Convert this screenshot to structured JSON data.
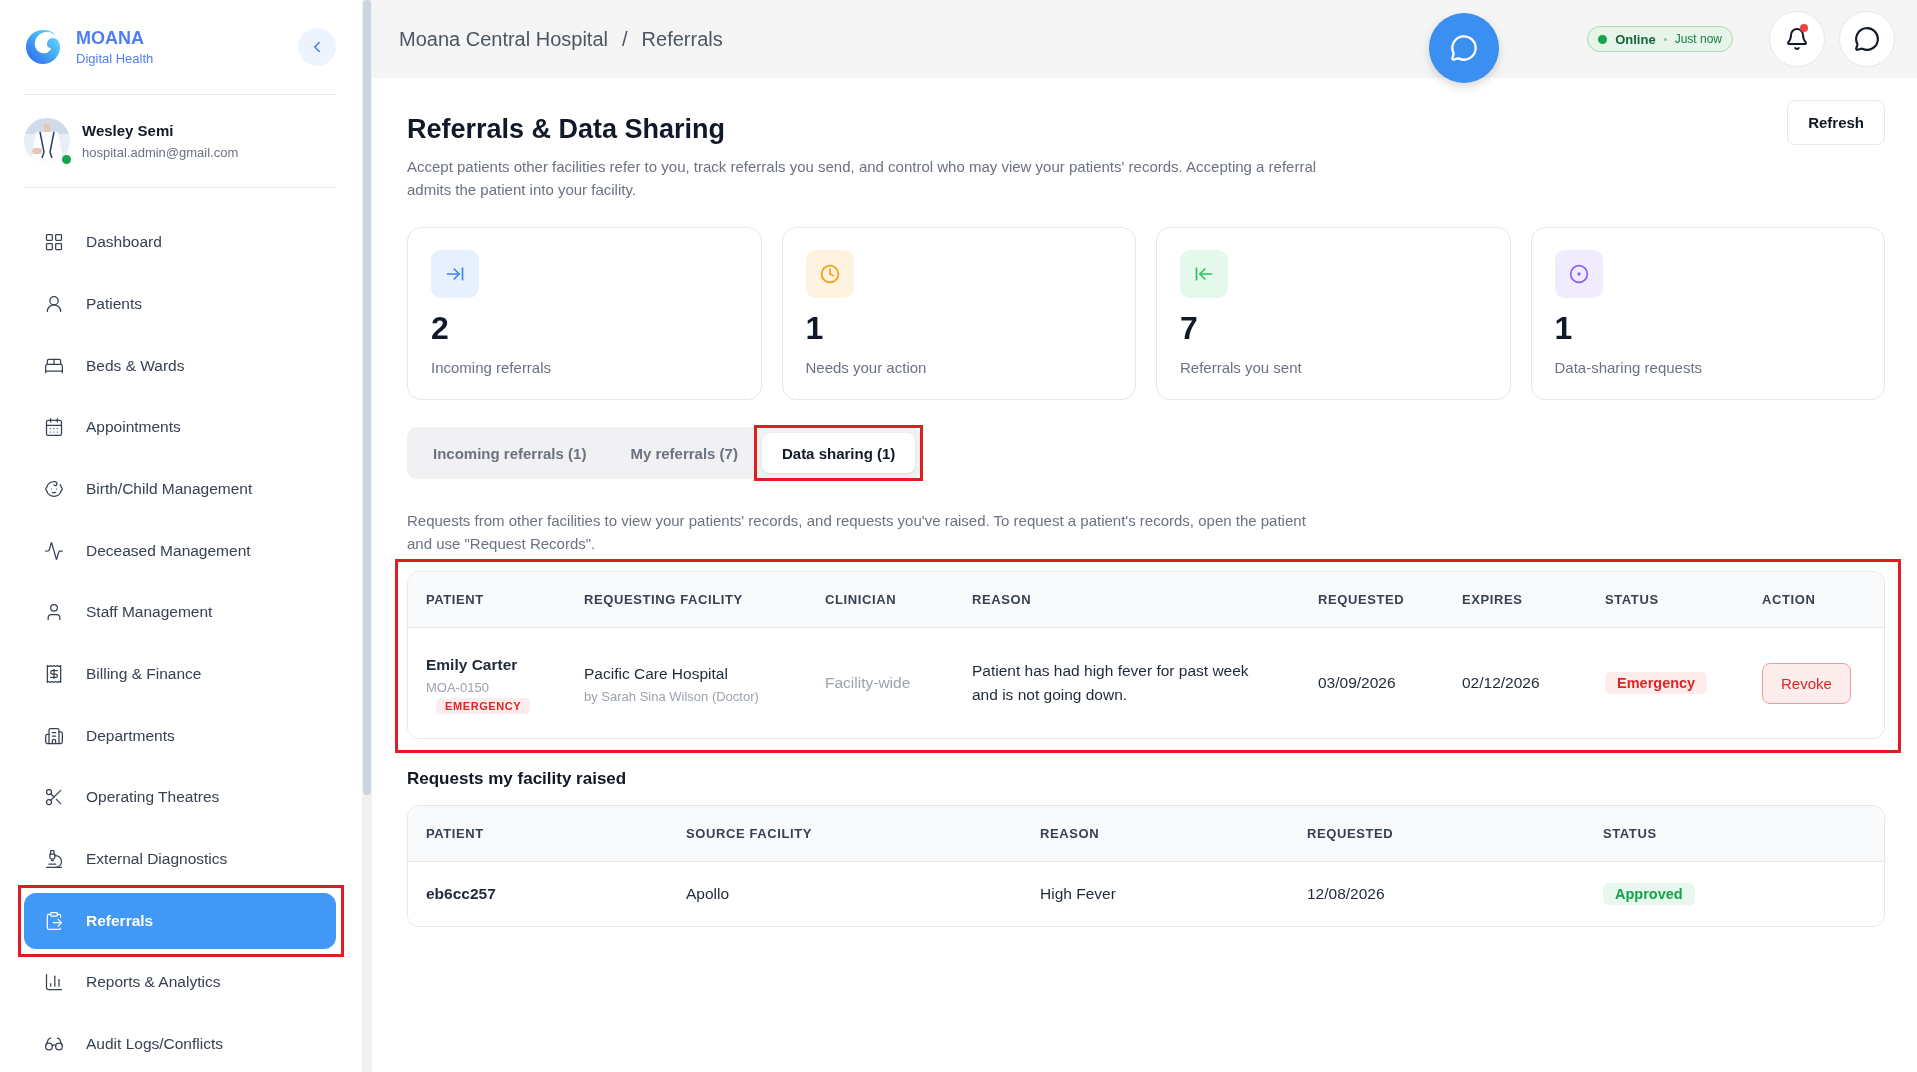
{
  "sidebar": {
    "brand": {
      "name": "MOANA",
      "tagline": "Digital Health"
    },
    "user": {
      "name": "Wesley Semi",
      "email": "hospital.admin@gmail.com",
      "online": true
    },
    "nav": [
      {
        "label": "Dashboard",
        "selected": false,
        "highlighted": false
      },
      {
        "label": "Patients",
        "selected": false,
        "highlighted": false
      },
      {
        "label": "Beds & Wards",
        "selected": false,
        "highlighted": false
      },
      {
        "label": "Appointments",
        "selected": false,
        "highlighted": false
      },
      {
        "label": "Birth/Child Management",
        "selected": false,
        "highlighted": false
      },
      {
        "label": "Deceased Management",
        "selected": false,
        "highlighted": false
      },
      {
        "label": "Staff Management",
        "selected": false,
        "highlighted": false
      },
      {
        "label": "Billing & Finance",
        "selected": false,
        "highlighted": false
      },
      {
        "label": "Departments",
        "selected": false,
        "highlighted": false
      },
      {
        "label": "Operating Theatres",
        "selected": false,
        "highlighted": false
      },
      {
        "label": "External Diagnostics",
        "selected": false,
        "highlighted": false
      },
      {
        "label": "Referrals",
        "selected": true,
        "highlighted": true
      },
      {
        "label": "Reports & Analytics",
        "selected": false,
        "highlighted": false
      },
      {
        "label": "Audit Logs/Conflicts",
        "selected": false,
        "highlighted": false
      }
    ]
  },
  "topbar": {
    "breadcrumb": [
      "Moana Central Hospital",
      "Referrals"
    ],
    "separator": "/",
    "status": {
      "label": "Online",
      "time": "Just now",
      "online": true
    },
    "notifications": {
      "unread": true
    }
  },
  "page": {
    "title": "Referrals & Data Sharing",
    "description": "Accept patients other facilities refer to you, track referrals you send, and control who may view your patients' records. Accepting a referral admits the patient into your facility.",
    "refresh": "Refresh"
  },
  "stats": [
    {
      "value": "2",
      "label": "Incoming referrals",
      "color": "#3b82f6"
    },
    {
      "value": "1",
      "label": "Needs your action",
      "color": "#f59e0b"
    },
    {
      "value": "7",
      "label": "Referrals you sent",
      "color": "#22c55e"
    },
    {
      "value": "1",
      "label": "Data-sharing requests",
      "color": "#8b5cf6"
    }
  ],
  "tabs": [
    {
      "label": "Incoming referrals (1)",
      "selected": false,
      "highlighted": false
    },
    {
      "label": "My referrals (7)",
      "selected": false,
      "highlighted": false
    },
    {
      "label": "Data sharing (1)",
      "selected": true,
      "highlighted": true
    }
  ],
  "incoming": {
    "description": "Requests from other facilities to view your patients' records, and requests you've raised. To request a patient's records, open the patient and use \"Request Records\".",
    "highlighted": true,
    "columns": [
      "PATIENT",
      "REQUESTING FACILITY",
      "CLINICIAN",
      "REASON",
      "REQUESTED",
      "EXPIRES",
      "STATUS",
      "ACTION"
    ],
    "rows": [
      {
        "patient": {
          "name": "Emily Carter",
          "id": "MOA-0150",
          "tag": {
            "label": "EMERGENCY",
            "kind": "emergency"
          }
        },
        "facility": {
          "name": "Pacific Care Hospital",
          "by": "by Sarah Sina Wilson (Doctor)"
        },
        "clinician": "Facility-wide",
        "reason": "Patient has had high fever for past week and is not going down.",
        "requested": "03/09/2026",
        "expires": "02/12/2026",
        "status": {
          "label": "Emergency",
          "kind": "emergency"
        },
        "action": "Revoke"
      }
    ]
  },
  "raised": {
    "title": "Requests my facility raised",
    "columns": [
      "PATIENT",
      "SOURCE FACILITY",
      "REASON",
      "REQUESTED",
      "STATUS"
    ],
    "rows": [
      {
        "patient": "eb6cc257",
        "source": "Apollo",
        "reason": "High Fever",
        "requested": "12/08/2026",
        "status": {
          "label": "Approved",
          "kind": "approved"
        }
      }
    ]
  }
}
